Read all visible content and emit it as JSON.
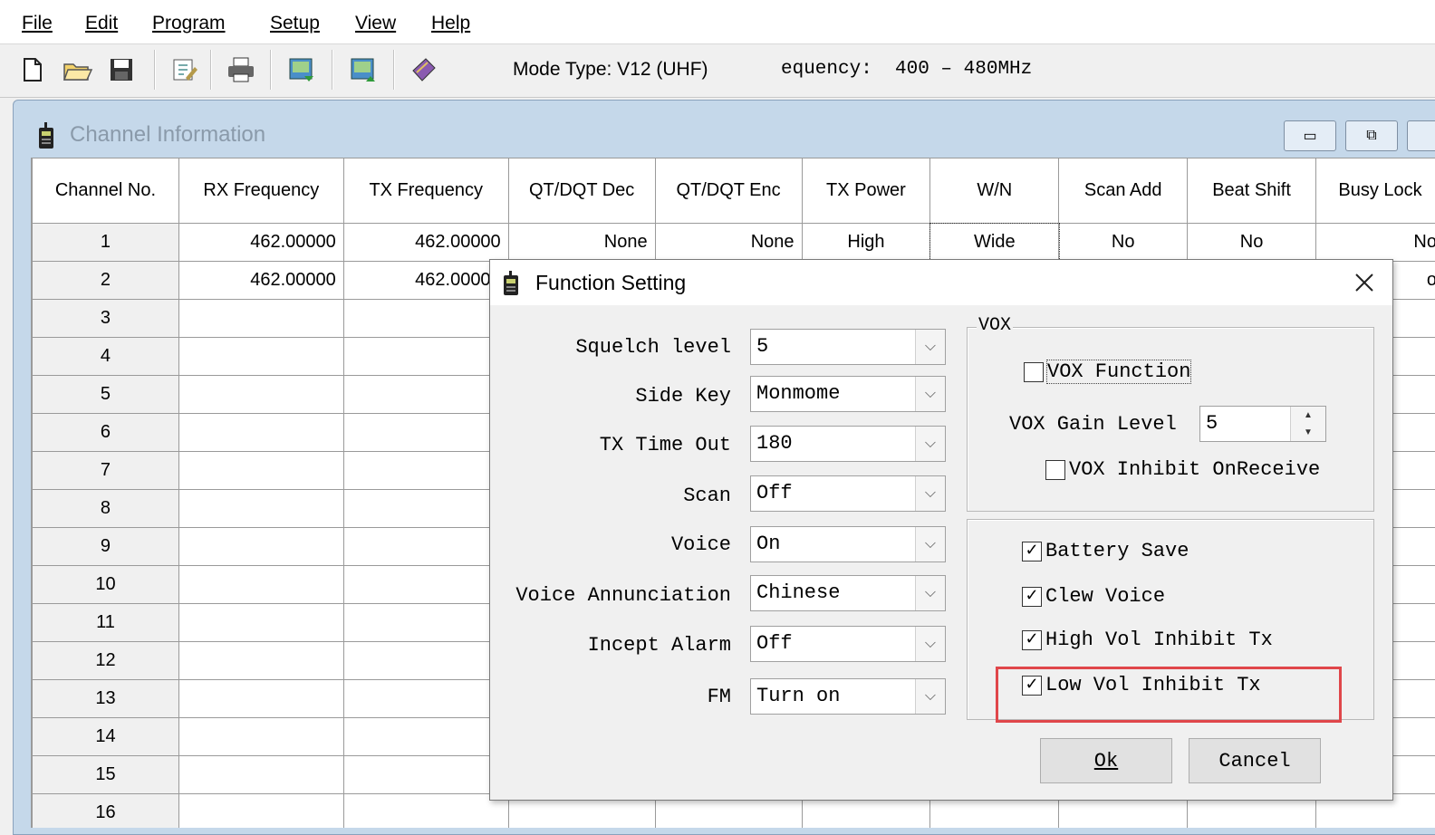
{
  "menu": {
    "file": "File",
    "edit": "Edit",
    "program": "Program",
    "setup": "Setup",
    "view": "View",
    "help": "Help"
  },
  "toolbar": {
    "icons": [
      "new-file-icon",
      "open-folder-icon",
      "save-icon",
      "edit-icon",
      "print-icon",
      "read-radio-icon",
      "write-radio-icon",
      "book-icon"
    ],
    "mode_type": "Mode Type: V12 (UHF)",
    "frequency": "equency:  400 – 480MHz"
  },
  "child_window": {
    "title": "Channel Information",
    "columns": [
      "Channel No.",
      "RX Frequency",
      "TX Frequency",
      "QT/DQT Dec",
      "QT/DQT Enc",
      "TX Power",
      "W/N",
      "Scan Add",
      "Beat Shift",
      "Busy Lock"
    ],
    "rows": [
      [
        "1",
        "462.00000",
        "462.00000",
        "None",
        "None",
        "High",
        "Wide",
        "No",
        "No",
        "No"
      ],
      [
        "2",
        "462.00000",
        "462.00000",
        "",
        "",
        "",
        "",
        "",
        "",
        "o"
      ],
      [
        "3"
      ],
      [
        "4"
      ],
      [
        "5"
      ],
      [
        "6"
      ],
      [
        "7"
      ],
      [
        "8"
      ],
      [
        "9"
      ],
      [
        "10"
      ],
      [
        "11"
      ],
      [
        "12"
      ],
      [
        "13"
      ],
      [
        "14"
      ],
      [
        "15"
      ],
      [
        "16"
      ]
    ]
  },
  "dialog": {
    "title": "Function Setting",
    "fields": [
      {
        "label": "Squelch level",
        "value": "5"
      },
      {
        "label": "Side Key",
        "value": "Monmome"
      },
      {
        "label": "TX Time Out",
        "value": "180"
      },
      {
        "label": "Scan",
        "value": "Off"
      },
      {
        "label": "Voice",
        "value": "On"
      },
      {
        "label": "Voice Annunciation",
        "value": "Chinese"
      },
      {
        "label": "Incept Alarm",
        "value": "Off"
      },
      {
        "label": "FM",
        "value": "Turn on"
      }
    ],
    "vox": {
      "legend": "VOX",
      "function_label": "VOX Function",
      "gain_label": "VOX Gain Level",
      "gain_value": "5",
      "inhibit_label": "VOX Inhibit OnReceive"
    },
    "options": [
      {
        "label": "Battery Save",
        "checked": true
      },
      {
        "label": "Clew Voice",
        "checked": true
      },
      {
        "label": "High Vol Inhibit Tx",
        "checked": true
      },
      {
        "label": "Low Vol Inhibit Tx",
        "checked": true
      }
    ],
    "ok": "Ok",
    "cancel": "Cancel",
    "highlight_color": "#e0464a"
  }
}
